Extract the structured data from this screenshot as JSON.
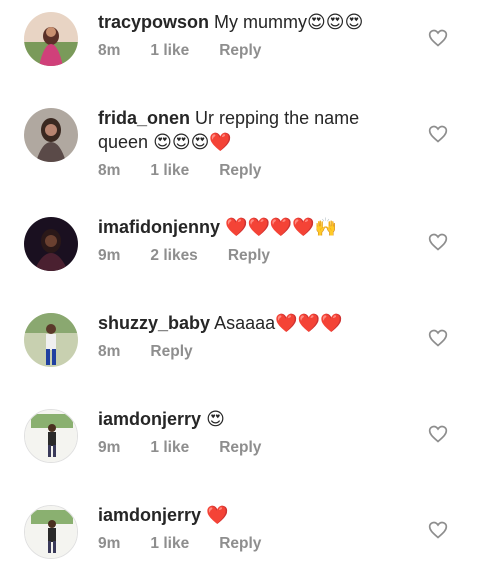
{
  "comments": [
    {
      "username": "tracypowson",
      "text": "My mummy",
      "emoji": "😍😍😍",
      "time": "8m",
      "likes": "1 like",
      "reply": "Reply",
      "avatar_color": "#c66a7a"
    },
    {
      "username": "frida_onen",
      "text": "Ur repping the name queen",
      "emoji": "😍😍😍❤️",
      "time": "8m",
      "likes": "1 like",
      "reply": "Reply",
      "avatar_color": "#7a6a68"
    },
    {
      "username": "imafidonjenny",
      "text": "",
      "emoji": "❤️❤️❤️❤️🙌",
      "time": "9m",
      "likes": "2 likes",
      "reply": "Reply",
      "avatar_color": "#3a2030"
    },
    {
      "username": "shuzzy_baby",
      "text": "Asaaaa",
      "emoji": "❤️❤️❤️",
      "time": "8m",
      "likes": "",
      "reply": "Reply",
      "avatar_color": "#5a7a4a"
    },
    {
      "username": "iamdonjerry",
      "text": "",
      "emoji": "😍",
      "time": "9m",
      "likes": "1 like",
      "reply": "Reply",
      "avatar_color": "#6a8a5a"
    },
    {
      "username": "iamdonjerry",
      "text": "",
      "emoji": "❤️",
      "time": "9m",
      "likes": "1 like",
      "reply": "Reply",
      "avatar_color": "#6a8a5a"
    }
  ],
  "icons": {
    "like": "heart-outline-icon"
  },
  "colors": {
    "username": "#262626",
    "meta": "#8e8e8e",
    "heart_red": "#e0262e",
    "background": "#ffffff"
  }
}
